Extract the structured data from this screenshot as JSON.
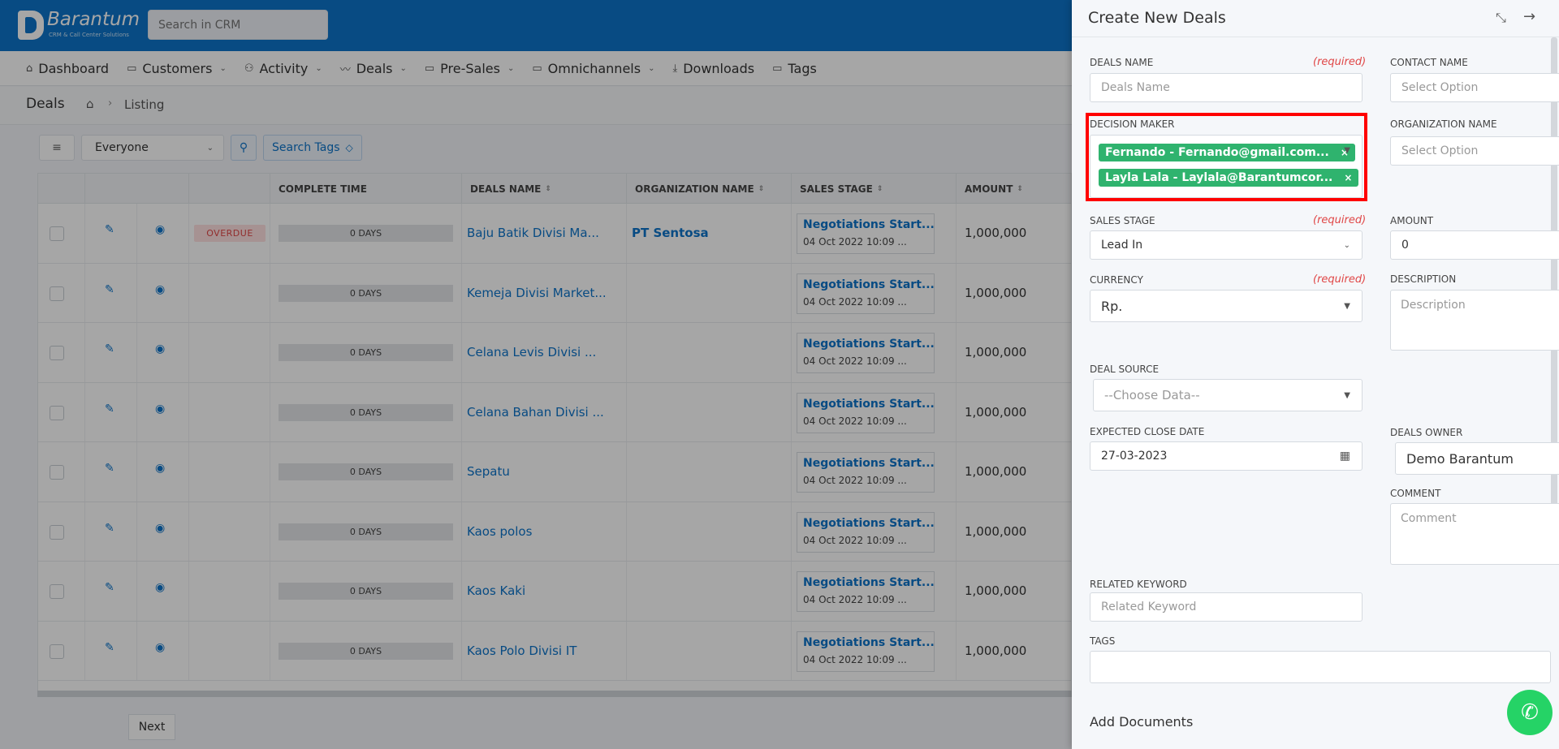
{
  "header": {
    "logo_name": "Barantum",
    "logo_sub": "CRM & Call Center Solutions",
    "search_placeholder": "Search in CRM"
  },
  "nav": {
    "items": [
      {
        "label": "Dashboard",
        "icon": "home-icon",
        "dropdown": false
      },
      {
        "label": "Customers",
        "icon": "folder-icon",
        "dropdown": true
      },
      {
        "label": "Activity",
        "icon": "users-icon",
        "dropdown": true
      },
      {
        "label": "Deals",
        "icon": "chart-icon",
        "dropdown": true
      },
      {
        "label": "Pre-Sales",
        "icon": "folder-icon",
        "dropdown": true
      },
      {
        "label": "Omnichannels",
        "icon": "folder-icon",
        "dropdown": true
      },
      {
        "label": "Downloads",
        "icon": "download-icon",
        "dropdown": false
      },
      {
        "label": "Tags",
        "icon": "folder-icon",
        "dropdown": false
      }
    ]
  },
  "breadcrumb": {
    "title": "Deals",
    "current": "Listing"
  },
  "toolbar": {
    "owner_filter": "Everyone",
    "search_tags_label": "Search Tags"
  },
  "table": {
    "columns": {
      "complete_time": "COMPLETE TIME",
      "deals_name": "DEALS NAME",
      "organization_name": "ORGANIZATION NAME",
      "sales_stage": "SALES STAGE",
      "amount": "AMOUNT"
    },
    "rows": [
      {
        "overdue": "OVERDUE",
        "days": "0 DAYS",
        "deal": "Baju Batik Divisi Ma...",
        "org": "PT Sentosa",
        "stage": "Negotiations Start...",
        "stage_date": "04 Oct 2022 10:09 ...",
        "amount": "1,000,000"
      },
      {
        "overdue": "",
        "days": "0 DAYS",
        "deal": "Kemeja Divisi Market...",
        "org": "",
        "stage": "Negotiations Start...",
        "stage_date": "04 Oct 2022 10:09 ...",
        "amount": "1,000,000"
      },
      {
        "overdue": "",
        "days": "0 DAYS",
        "deal": "Celana Levis Divisi ...",
        "org": "",
        "stage": "Negotiations Start...",
        "stage_date": "04 Oct 2022 10:09 ...",
        "amount": "1,000,000"
      },
      {
        "overdue": "",
        "days": "0 DAYS",
        "deal": "Celana Bahan Divisi ...",
        "org": "",
        "stage": "Negotiations Start...",
        "stage_date": "04 Oct 2022 10:09 ...",
        "amount": "1,000,000"
      },
      {
        "overdue": "",
        "days": "0 DAYS",
        "deal": "Sepatu",
        "org": "",
        "stage": "Negotiations Start...",
        "stage_date": "04 Oct 2022 10:09 ...",
        "amount": "1,000,000"
      },
      {
        "overdue": "",
        "days": "0 DAYS",
        "deal": "Kaos polos",
        "org": "",
        "stage": "Negotiations Start...",
        "stage_date": "04 Oct 2022 10:09 ...",
        "amount": "1,000,000"
      },
      {
        "overdue": "",
        "days": "0 DAYS",
        "deal": "Kaos Kaki",
        "org": "",
        "stage": "Negotiations Start...",
        "stage_date": "04 Oct 2022 10:09 ...",
        "amount": "1,000,000"
      },
      {
        "overdue": "",
        "days": "0 DAYS",
        "deal": "Kaos Polo Divisi IT",
        "org": "",
        "stage": "Negotiations Start...",
        "stage_date": "04 Oct 2022 10:09 ...",
        "amount": "1,000,000"
      }
    ]
  },
  "pagination": {
    "next_label": "Next"
  },
  "drawer": {
    "title": "Create New Deals",
    "required_label": "(required)",
    "deals_name": {
      "label": "DEALS NAME",
      "placeholder": "Deals Name"
    },
    "contact_name": {
      "label": "CONTACT NAME",
      "placeholder": "Select Option"
    },
    "decision_maker": {
      "label": "DECISION MAKER",
      "chips": [
        "Fernando - Fernando@gmail.com...",
        "Layla Lala - Laylala@Barantumcor..."
      ]
    },
    "organization_name": {
      "label": "ORGANIZATION NAME",
      "placeholder": "Select Option"
    },
    "sales_stage": {
      "label": "SALES STAGE",
      "value": "Lead In"
    },
    "amount": {
      "label": "AMOUNT",
      "value": "0"
    },
    "currency": {
      "label": "CURRENCY",
      "value": "Rp."
    },
    "description": {
      "label": "DESCRIPTION",
      "placeholder": "Description"
    },
    "deal_source": {
      "label": "DEAL SOURCE",
      "placeholder": "--Choose Data--"
    },
    "expected_close_date": {
      "label": "EXPECTED CLOSE DATE",
      "value": "27-03-2023"
    },
    "deals_owner": {
      "label": "DEALS OWNER",
      "value": "Demo Barantum"
    },
    "comment": {
      "label": "COMMENT",
      "placeholder": "Comment"
    },
    "related_keyword": {
      "label": "RELATED KEYWORD",
      "placeholder": "Related Keyword"
    },
    "tags": {
      "label": "TAGS"
    },
    "add_documents": "Add Documents"
  },
  "colors": {
    "brand": "#0d74c9",
    "chip": "#2fb36e",
    "required": "#e04646",
    "highlight": "#ff0000",
    "whatsapp": "#25d366"
  }
}
